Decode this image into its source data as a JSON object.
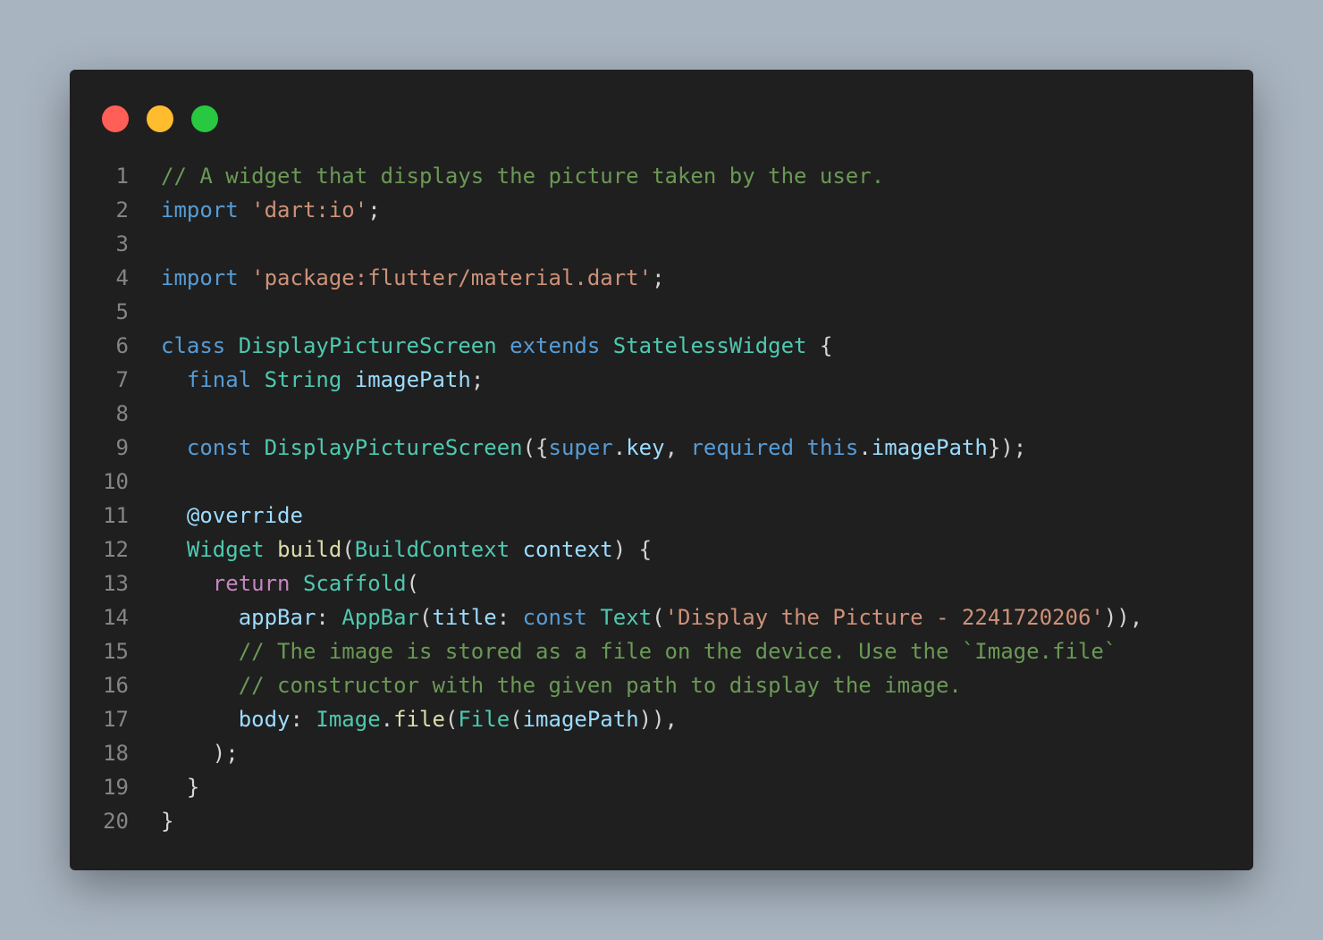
{
  "window": {
    "controls": [
      {
        "name": "close",
        "color": "#ff5f57"
      },
      {
        "name": "minimize",
        "color": "#febc2e"
      },
      {
        "name": "zoom",
        "color": "#28c840"
      }
    ]
  },
  "colors": {
    "comment": "#6a9955",
    "keyword": "#569cd6",
    "control": "#c586c0",
    "string": "#ce9178",
    "type": "#4ec9b0",
    "variable": "#9cdcfe",
    "function": "#dcdcaa",
    "punctuation": "#d4d4d4",
    "line_number": "#858585",
    "background": "#1f1f1f"
  },
  "code": {
    "lines": [
      {
        "n": "1",
        "tokens": [
          [
            "comment",
            "// A widget that displays the picture taken by the user."
          ]
        ]
      },
      {
        "n": "2",
        "tokens": [
          [
            "keyword",
            "import"
          ],
          [
            "plain",
            " "
          ],
          [
            "string",
            "'dart:io'"
          ],
          [
            "punct",
            ";"
          ]
        ]
      },
      {
        "n": "3",
        "tokens": []
      },
      {
        "n": "4",
        "tokens": [
          [
            "keyword",
            "import"
          ],
          [
            "plain",
            " "
          ],
          [
            "string",
            "'package:flutter/material.dart'"
          ],
          [
            "punct",
            ";"
          ]
        ]
      },
      {
        "n": "5",
        "tokens": []
      },
      {
        "n": "6",
        "tokens": [
          [
            "keyword",
            "class"
          ],
          [
            "plain",
            " "
          ],
          [
            "type",
            "DisplayPictureScreen"
          ],
          [
            "plain",
            " "
          ],
          [
            "keyword",
            "extends"
          ],
          [
            "plain",
            " "
          ],
          [
            "type",
            "StatelessWidget"
          ],
          [
            "plain",
            " "
          ],
          [
            "punct",
            "{"
          ]
        ]
      },
      {
        "n": "7",
        "tokens": [
          [
            "plain",
            "  "
          ],
          [
            "keyword",
            "final"
          ],
          [
            "plain",
            " "
          ],
          [
            "type",
            "String"
          ],
          [
            "plain",
            " "
          ],
          [
            "var",
            "imagePath"
          ],
          [
            "punct",
            ";"
          ]
        ]
      },
      {
        "n": "8",
        "tokens": []
      },
      {
        "n": "9",
        "tokens": [
          [
            "plain",
            "  "
          ],
          [
            "keyword",
            "const"
          ],
          [
            "plain",
            " "
          ],
          [
            "type",
            "DisplayPictureScreen"
          ],
          [
            "punct",
            "({"
          ],
          [
            "keyword",
            "super"
          ],
          [
            "punct",
            "."
          ],
          [
            "var",
            "key"
          ],
          [
            "punct",
            ", "
          ],
          [
            "keyword",
            "required"
          ],
          [
            "plain",
            " "
          ],
          [
            "keyword",
            "this"
          ],
          [
            "punct",
            "."
          ],
          [
            "var",
            "imagePath"
          ],
          [
            "punct",
            "});"
          ]
        ]
      },
      {
        "n": "10",
        "tokens": []
      },
      {
        "n": "11",
        "tokens": [
          [
            "plain",
            "  "
          ],
          [
            "var",
            "@override"
          ]
        ]
      },
      {
        "n": "12",
        "tokens": [
          [
            "plain",
            "  "
          ],
          [
            "type",
            "Widget"
          ],
          [
            "plain",
            " "
          ],
          [
            "func",
            "build"
          ],
          [
            "punct",
            "("
          ],
          [
            "type",
            "BuildContext"
          ],
          [
            "plain",
            " "
          ],
          [
            "var",
            "context"
          ],
          [
            "punct",
            ") {"
          ]
        ]
      },
      {
        "n": "13",
        "tokens": [
          [
            "plain",
            "    "
          ],
          [
            "control",
            "return"
          ],
          [
            "plain",
            " "
          ],
          [
            "type",
            "Scaffold"
          ],
          [
            "punct",
            "("
          ]
        ]
      },
      {
        "n": "14",
        "tokens": [
          [
            "plain",
            "      "
          ],
          [
            "var",
            "appBar"
          ],
          [
            "punct",
            ": "
          ],
          [
            "type",
            "AppBar"
          ],
          [
            "punct",
            "("
          ],
          [
            "var",
            "title"
          ],
          [
            "punct",
            ": "
          ],
          [
            "keyword",
            "const"
          ],
          [
            "plain",
            " "
          ],
          [
            "type",
            "Text"
          ],
          [
            "punct",
            "("
          ],
          [
            "string",
            "'Display the Picture - 2241720206'"
          ],
          [
            "punct",
            ")),"
          ]
        ]
      },
      {
        "n": "15",
        "tokens": [
          [
            "plain",
            "      "
          ],
          [
            "comment",
            "// The image is stored as a file on the device. Use the `Image.file`"
          ]
        ]
      },
      {
        "n": "16",
        "tokens": [
          [
            "plain",
            "      "
          ],
          [
            "comment",
            "// constructor with the given path to display the image."
          ]
        ]
      },
      {
        "n": "17",
        "tokens": [
          [
            "plain",
            "      "
          ],
          [
            "var",
            "body"
          ],
          [
            "punct",
            ": "
          ],
          [
            "type",
            "Image"
          ],
          [
            "punct",
            "."
          ],
          [
            "func",
            "file"
          ],
          [
            "punct",
            "("
          ],
          [
            "type",
            "File"
          ],
          [
            "punct",
            "("
          ],
          [
            "var",
            "imagePath"
          ],
          [
            "punct",
            ")),"
          ]
        ]
      },
      {
        "n": "18",
        "tokens": [
          [
            "plain",
            "    "
          ],
          [
            "punct",
            ");"
          ]
        ]
      },
      {
        "n": "19",
        "tokens": [
          [
            "plain",
            "  "
          ],
          [
            "punct",
            "}"
          ]
        ]
      },
      {
        "n": "20",
        "tokens": [
          [
            "punct",
            "}"
          ]
        ]
      }
    ]
  }
}
